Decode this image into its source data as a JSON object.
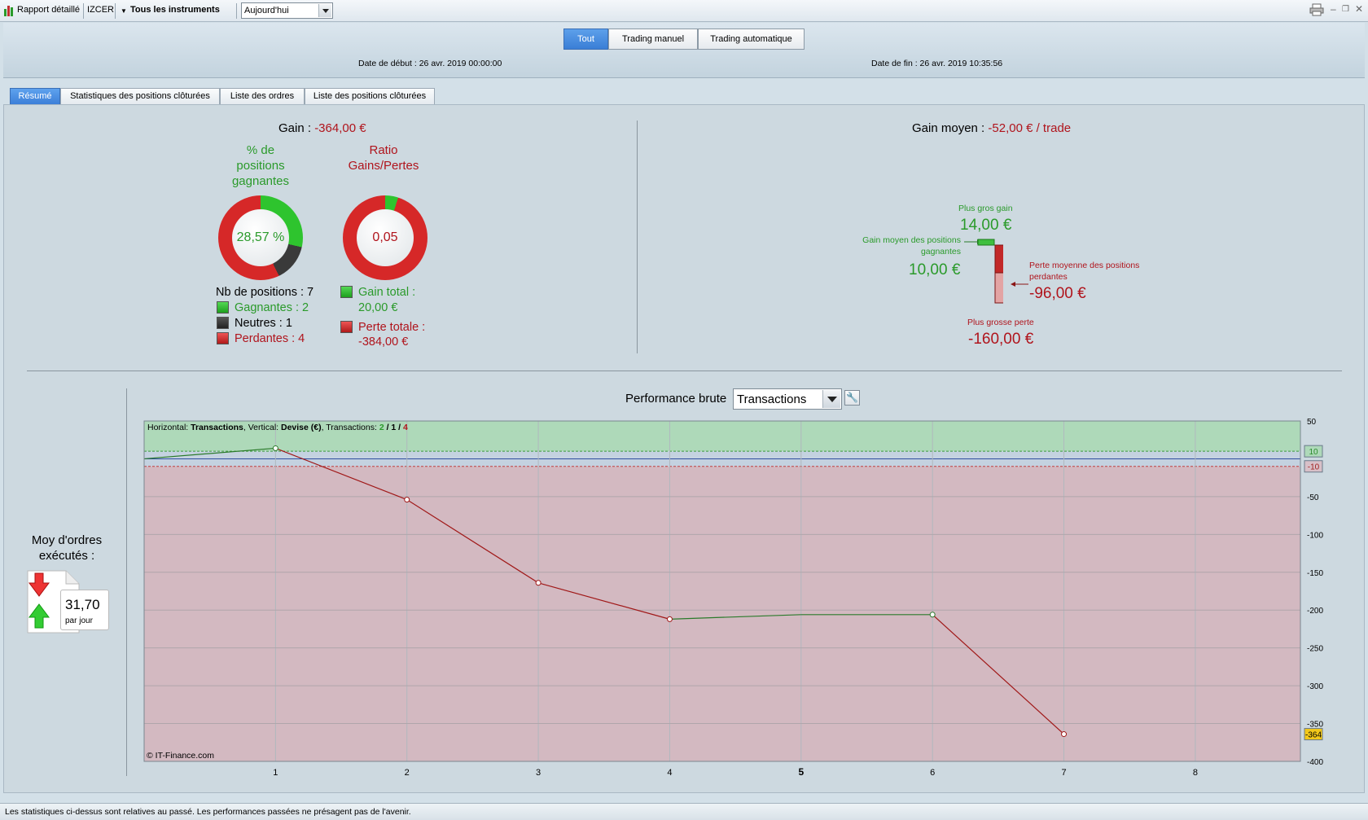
{
  "toolbar": {
    "report_label": "Rapport détaillé",
    "account": "IZCER",
    "instruments_label": "Tous les instruments",
    "period_value": "Aujourd'hui"
  },
  "header": {
    "filters": [
      "Tout",
      "Trading manuel",
      "Trading automatique"
    ],
    "active_filter": "Tout",
    "start_date": "Date de début :  26 avr. 2019 00:00:00",
    "end_date": "Date de fin :  26 avr. 2019 10:35:56"
  },
  "tabs": [
    {
      "label": "Résumé",
      "active": true
    },
    {
      "label": "Statistiques des positions clôturées",
      "active": false
    },
    {
      "label": "Liste des ordres",
      "active": false
    },
    {
      "label": "Liste des positions clôturées",
      "active": false
    }
  ],
  "summary": {
    "gain_label": "Gain : ",
    "gain_value": "-364,00 €",
    "winning_pct_title": "% de positions gagnantes",
    "winning_pct_title_lines": [
      "% de",
      "positions",
      "gagnantes"
    ],
    "winning_pct_value": "28,57 %",
    "winning_pct_fraction": 0.2857,
    "neutral_fraction": 0.1429,
    "ratio_title_lines": [
      "Ratio",
      "Gains/Pertes"
    ],
    "ratio_value": "0,05",
    "ratio_fraction": 0.05,
    "nb_positions": "Nb de positions : 7",
    "gagnantes": "Gagnantes : 2",
    "neutres": "Neutres : 1",
    "perdantes": "Perdantes : 4",
    "gain_total_label": "Gain total :",
    "gain_total_value": "20,00 €",
    "perte_totale_label": "Perte totale :",
    "perte_totale_value": "-384,00 €"
  },
  "average": {
    "gain_moyen_label": "Gain moyen : ",
    "gain_moyen_value": "-52,00 € / trade",
    "plus_gros_gain_label": "Plus gros gain",
    "plus_gros_gain_value": "14,00 €",
    "gain_moyen_gagnantes_label_lines": [
      "Gain moyen des positions",
      "gagnantes"
    ],
    "gain_moyen_gagnantes_value": "10,00 €",
    "perte_moyenne_label_lines": [
      "Perte moyenne des positions",
      "perdantes"
    ],
    "perte_moyenne_value": "-96,00 €",
    "plus_grosse_perte_label": "Plus grosse perte",
    "plus_grosse_perte_value": "-160,00 €"
  },
  "orders": {
    "title_lines": [
      "Moy d'ordres",
      "exécutés :"
    ],
    "value": "31,70",
    "unit": "par jour"
  },
  "performance": {
    "title": "Performance brute",
    "selector_value": "Transactions"
  },
  "chart_data": {
    "type": "line",
    "legend_prefix": "Horizontal: ",
    "legend_h": "Transactions",
    "legend_mid": ", Vertical: ",
    "legend_v": "Devise (€)",
    "legend_mid2": ", Transactions: ",
    "legend_win": "2",
    "legend_neu": "1",
    "legend_loss": "4",
    "copyright": "© IT-Finance.com",
    "x": [
      0,
      1,
      2,
      3,
      4,
      5,
      6,
      7
    ],
    "y": [
      0,
      14,
      -54,
      -164,
      -212,
      -206,
      -206,
      -364
    ],
    "segment_colors": [
      "#2a7a2a",
      "#a01818",
      "#a01818",
      "#a01818",
      "#2a7a2a",
      "#2a7a2a",
      "#a01818"
    ],
    "xlim": [
      0,
      8.8
    ],
    "ylim": [
      -400,
      50
    ],
    "x_ticks": [
      1,
      2,
      3,
      4,
      5,
      6,
      7,
      8
    ],
    "y_ticks": [
      50,
      -50,
      -100,
      -150,
      -200,
      -250,
      -300,
      -350,
      -400
    ],
    "bands": {
      "green_above": 10,
      "red_below": -10
    },
    "markers": {
      "upper": "10",
      "lower": "-10",
      "last": "-364"
    },
    "colors": {
      "gain_zone": "#aed9b9",
      "loss_zone": "#d3b9c1",
      "gain_line": "#2a7a2a",
      "loss_line": "#a01818"
    }
  }
}
